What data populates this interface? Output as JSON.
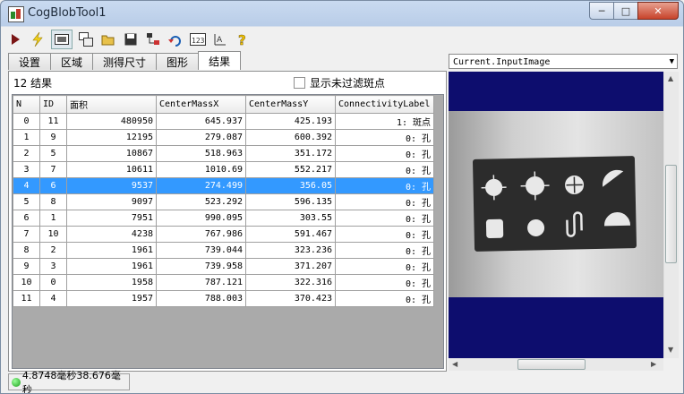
{
  "window": {
    "title": "CogBlobTool1"
  },
  "tabs": [
    "设置",
    "区域",
    "测得尺寸",
    "图形",
    "结果"
  ],
  "results": {
    "count_label": "12 结果",
    "show_unfiltered_label": "显示未过滤斑点"
  },
  "table": {
    "headers": [
      "N",
      "ID",
      "面积",
      "CenterMassX",
      "CenterMassY",
      "ConnectivityLabel"
    ],
    "rows": [
      [
        "0",
        "11",
        "480950",
        "645.937",
        "425.193",
        "1: 斑点"
      ],
      [
        "1",
        "9",
        "12195",
        "279.087",
        "600.392",
        "0: 孔"
      ],
      [
        "2",
        "5",
        "10867",
        "518.963",
        "351.172",
        "0: 孔"
      ],
      [
        "3",
        "7",
        "10611",
        "1010.69",
        "552.217",
        "0: 孔"
      ],
      [
        "4",
        "6",
        "9537",
        "274.499",
        "356.05",
        "0: 孔"
      ],
      [
        "5",
        "8",
        "9097",
        "523.292",
        "596.135",
        "0: 孔"
      ],
      [
        "6",
        "1",
        "7951",
        "990.095",
        "303.55",
        "0: 孔"
      ],
      [
        "7",
        "10",
        "4238",
        "767.986",
        "591.467",
        "0: 孔"
      ],
      [
        "8",
        "2",
        "1961",
        "739.044",
        "323.236",
        "0: 孔"
      ],
      [
        "9",
        "3",
        "1961",
        "739.958",
        "371.207",
        "0: 孔"
      ],
      [
        "10",
        "0",
        "1958",
        "787.121",
        "322.316",
        "0: 孔"
      ],
      [
        "11",
        "4",
        "1957",
        "788.003",
        "370.423",
        "0: 孔"
      ]
    ],
    "selected_row": 4
  },
  "display": {
    "image_selector": "Current.InputImage"
  },
  "status": {
    "text": "4.8748毫秒38.676毫秒"
  },
  "colors": {
    "selection": "#3399ff",
    "display_background": "#0d0d6e",
    "status_led": "#1b9d1b"
  }
}
